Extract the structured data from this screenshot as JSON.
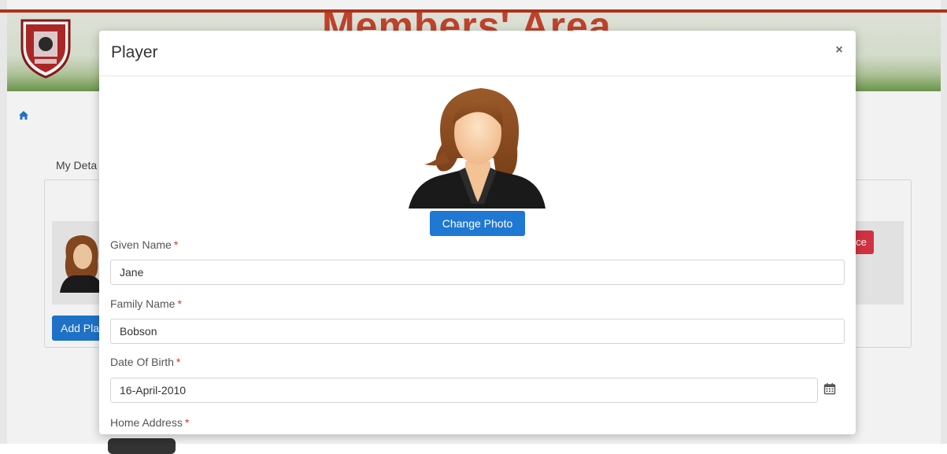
{
  "background": {
    "banner_title": "Members' Area",
    "tab_label": "My Deta",
    "row_action_label": "ce",
    "add_button_label": "Add Pla"
  },
  "modal": {
    "title": "Player",
    "close_label": "×",
    "change_photo_label": "Change Photo",
    "required_marker": "*",
    "fields": {
      "given_name": {
        "label": "Given Name",
        "value": "Jane"
      },
      "family_name": {
        "label": "Family Name",
        "value": "Bobson"
      },
      "date_of_birth": {
        "label": "Date Of Birth",
        "value": "16-April-2010"
      },
      "home_address": {
        "label": "Home Address"
      }
    }
  },
  "colors": {
    "accent": "#1f78d1",
    "danger": "#dc3545",
    "required": "#d9342b"
  },
  "icons": [
    "home-icon",
    "close-icon",
    "calendar-icon",
    "club-crest-logo",
    "avatar-placeholder"
  ]
}
